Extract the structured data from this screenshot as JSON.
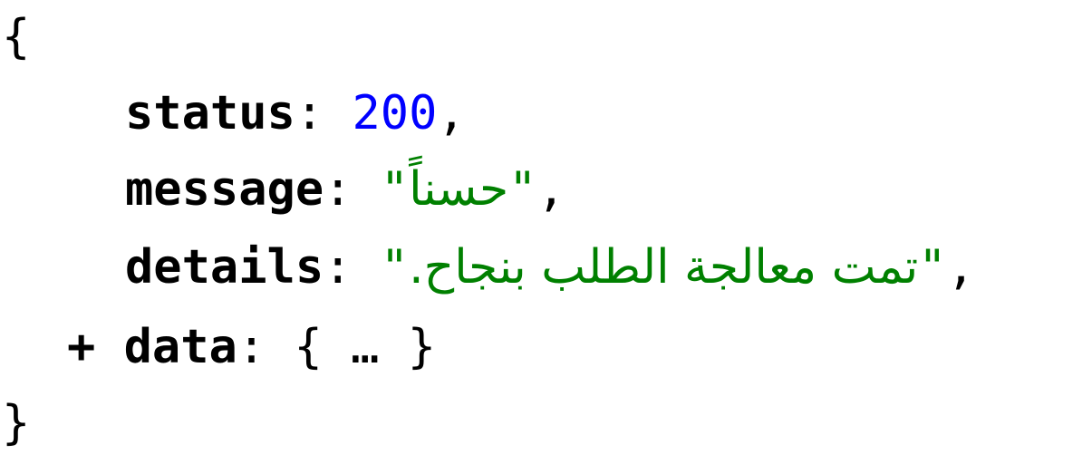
{
  "json_viewer": {
    "open_brace": "{",
    "close_brace": "}",
    "colon": ":",
    "comma": ",",
    "quote": "\"",
    "status": {
      "key": "status",
      "value": "200"
    },
    "message": {
      "key": "message",
      "value": "حسناً"
    },
    "details": {
      "key": "details",
      "value": "تمت معالجة الطلب بنجاح."
    },
    "data": {
      "expander": "+",
      "key": "data",
      "collapsed_open": "{",
      "collapsed_ellipsis": "…",
      "collapsed_close": "}"
    },
    "colors": {
      "number": "#0000ff",
      "string": "#008000",
      "key": "#000000"
    }
  }
}
